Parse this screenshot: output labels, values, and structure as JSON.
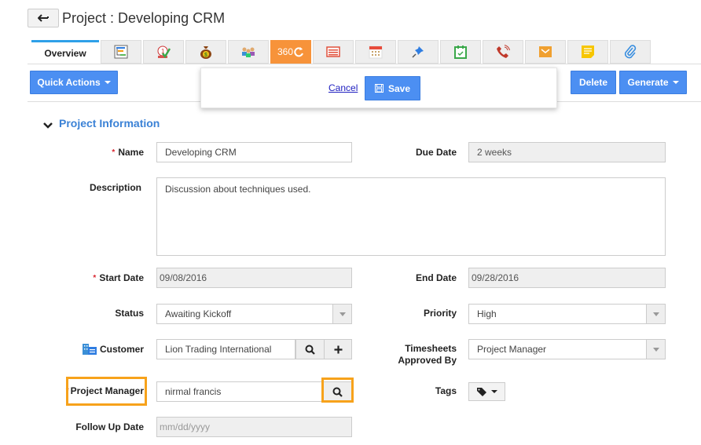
{
  "header": {
    "back_icon": "back-arrow-icon",
    "title": "Project : Developing CRM"
  },
  "tabs": [
    {
      "label": "Overview",
      "icon": null,
      "active": true
    },
    {
      "label": null,
      "icon": "gantt-chart-icon"
    },
    {
      "label": null,
      "icon": "task-checklist-icon"
    },
    {
      "label": null,
      "icon": "money-bag-icon"
    },
    {
      "label": null,
      "icon": "team-users-icon"
    },
    {
      "label": "360",
      "icon": "refresh-360-icon",
      "highlight_color": "#f7933a"
    },
    {
      "label": null,
      "icon": "invoice-list-icon"
    },
    {
      "label": null,
      "icon": "calendar-grid-icon"
    },
    {
      "label": null,
      "icon": "pushpin-icon"
    },
    {
      "label": null,
      "icon": "calendar-check-icon"
    },
    {
      "label": null,
      "icon": "phone-call-icon"
    },
    {
      "label": null,
      "icon": "email-envelope-icon"
    },
    {
      "label": null,
      "icon": "sticky-note-icon"
    },
    {
      "label": null,
      "icon": "paperclip-icon"
    }
  ],
  "toolbar": {
    "quick_actions": "Quick Actions",
    "delete": "Delete",
    "generate": "Generate"
  },
  "popup": {
    "cancel": "Cancel",
    "save": "Save"
  },
  "section": {
    "title": "Project Information"
  },
  "form": {
    "name": {
      "label": "Name",
      "value": "Developing CRM",
      "required": true
    },
    "due_date": {
      "label": "Due Date",
      "value": "2 weeks"
    },
    "description": {
      "label": "Description",
      "value": "Discussion about techniques used."
    },
    "start_date": {
      "label": "Start Date",
      "value": "09/08/2016",
      "required": true
    },
    "end_date": {
      "label": "End Date",
      "value": "09/28/2016"
    },
    "status": {
      "label": "Status",
      "value": "Awaiting Kickoff"
    },
    "priority": {
      "label": "Priority",
      "value": "High"
    },
    "customer": {
      "label": "Customer",
      "value": "Lion Trading International"
    },
    "timesheets_approved_by": {
      "label_line1": "Timesheets",
      "label_line2": "Approved By",
      "value": "Project Manager"
    },
    "project_manager": {
      "label": "Project Manager",
      "value": "nirmal francis",
      "required": true
    },
    "tags": {
      "label": "Tags"
    },
    "follow_up_date": {
      "label": "Follow Up Date",
      "placeholder": "mm/dd/yyyy"
    }
  },
  "colors": {
    "accent_blue": "#4c8ff2",
    "highlight_orange": "#f7a21b",
    "section_title": "#3b82d6"
  }
}
